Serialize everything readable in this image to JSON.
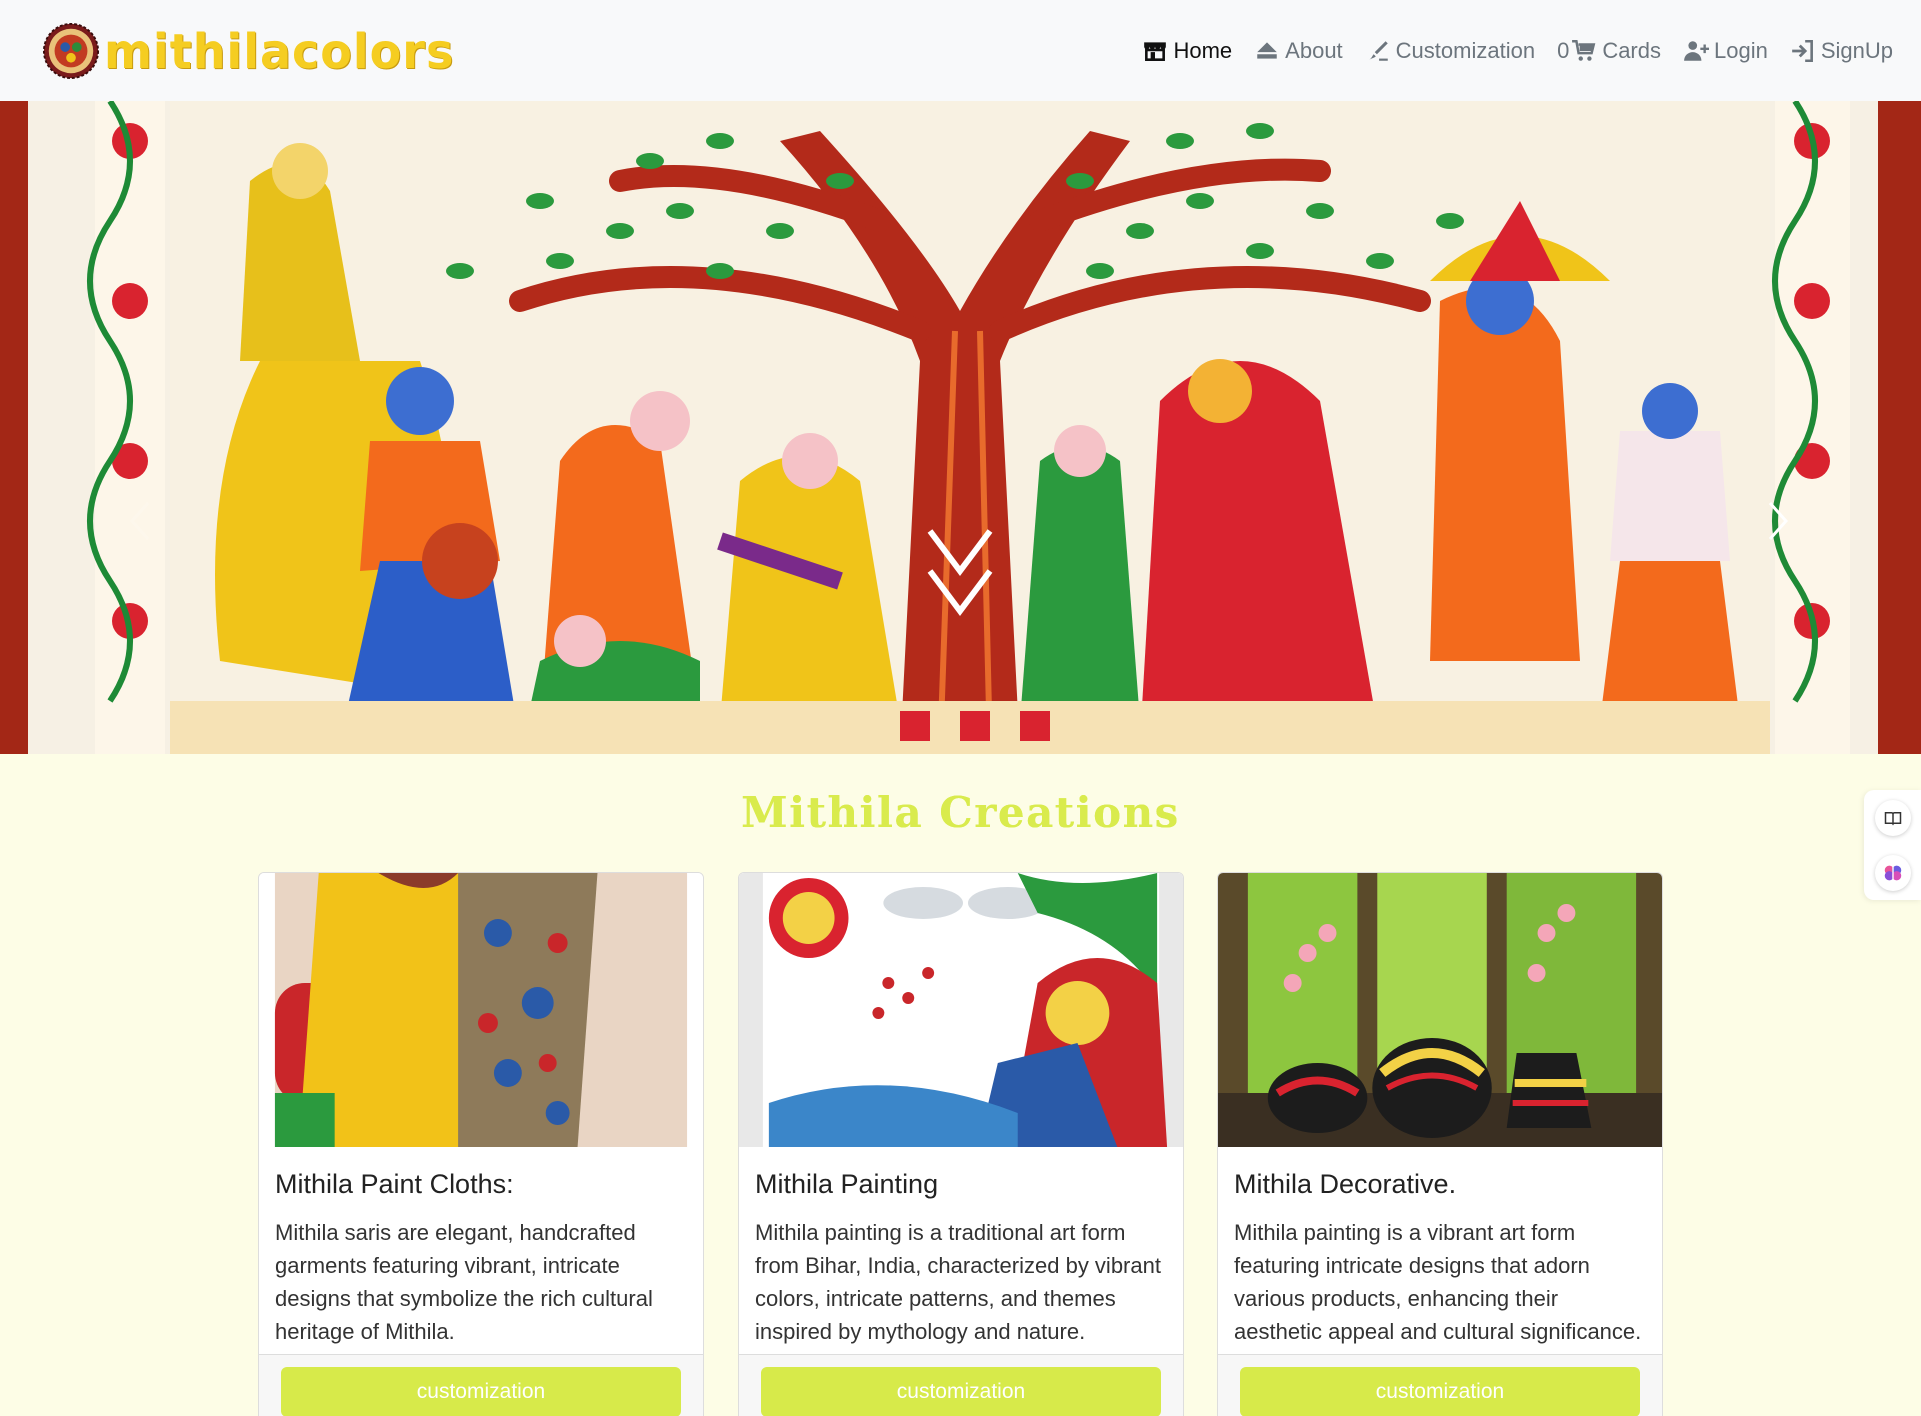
{
  "brand": {
    "name": "mithilacolors",
    "logo_icon": "madhubani-logo-icon"
  },
  "nav": {
    "home": "Home",
    "about": "About",
    "customization": "Customization",
    "cart_count": "0",
    "cards": "Cards",
    "login": "Login",
    "signup": "SignUp"
  },
  "hero": {
    "image": "madhubani-painting-carousel-slide"
  },
  "section": {
    "title": "Mithila Creations"
  },
  "cards": [
    {
      "title": "Mithila Paint Cloths:",
      "text": "Mithila saris are elegant, handcrafted garments featuring vibrant, intricate designs that symbolize the rich cultural heritage of Mithila.",
      "button": "customization"
    },
    {
      "title": "Mithila Painting",
      "text": "Mithila painting is a traditional art form from Bihar, India, characterized by vibrant colors, intricate patterns, and themes inspired by mythology and nature.",
      "button": "customization"
    },
    {
      "title": "Mithila Decorative.",
      "text": "Mithila painting is a vibrant art form featuring intricate designs that adorn various products, enhancing their aesthetic appeal and cultural significance.",
      "button": "customization"
    }
  ],
  "colors": {
    "accent": "#d7ea4a",
    "brand": "#f5cd21",
    "page_bg": "#fdfde6"
  }
}
